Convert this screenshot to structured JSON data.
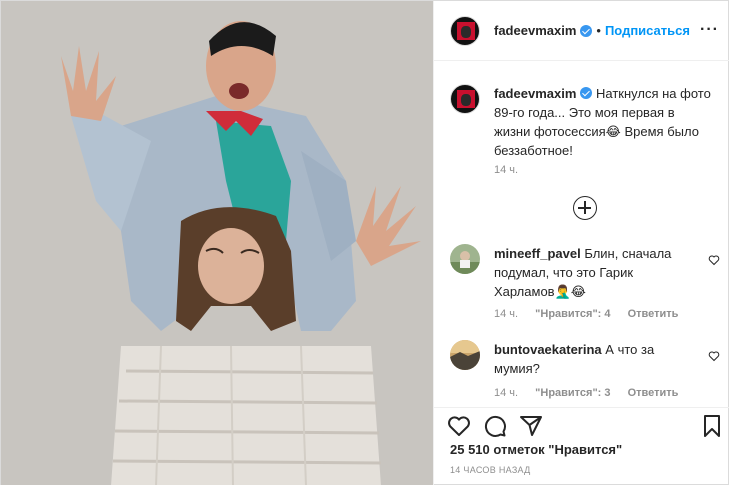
{
  "header": {
    "username": "fadeevmaxim",
    "separator": "•",
    "follow_label": "Подписаться",
    "more_label": "···"
  },
  "caption": {
    "username": "fadeevmaxim",
    "text": "Наткнулся на фото 89-го года... Это моя первая в жизни фотосессия😂 Время было беззаботное!",
    "time": "14 ч."
  },
  "comments": [
    {
      "username": "mineeff_pavel",
      "text": "Блин, сначала подумал, что это Гарик Харламов🤦‍♂️😂",
      "time": "14 ч.",
      "likes": "\"Нравится\": 4",
      "reply": "Ответить"
    },
    {
      "username": "buntovaekaterina",
      "text": "А что за мумия?",
      "time": "14 ч.",
      "likes": "\"Нравится\": 3",
      "reply": "Ответить"
    }
  ],
  "footer": {
    "likes": "25 510 отметок \"Нравится\"",
    "ago": "14 ЧАСОВ НАЗАД"
  },
  "icons": {
    "like": "heart-icon",
    "comment": "comment-icon",
    "share": "paper-plane-icon",
    "save": "bookmark-icon",
    "load_more": "plus-circle-icon",
    "verified": "verified-badge-icon"
  },
  "colors": {
    "accent": "#0095f6",
    "verified": "#3897f0",
    "muted": "#8e8e8e",
    "text": "#262626"
  }
}
